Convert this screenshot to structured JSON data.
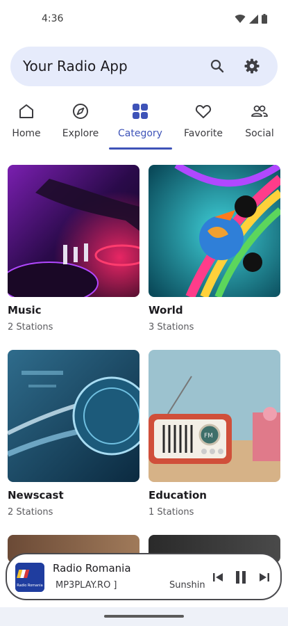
{
  "status_bar": {
    "time": "4:36"
  },
  "app_bar": {
    "title": "Your Radio App"
  },
  "tabs": [
    {
      "label": "Home",
      "icon": "home-icon"
    },
    {
      "label": "Explore",
      "icon": "compass-icon"
    },
    {
      "label": "Category",
      "icon": "grid-icon",
      "active": true
    },
    {
      "label": "Favorite",
      "icon": "heart-icon"
    },
    {
      "label": "Social",
      "icon": "people-icon"
    }
  ],
  "categories": [
    {
      "title": "Music",
      "count": "2 Stations"
    },
    {
      "title": "World",
      "count": "3 Stations"
    },
    {
      "title": "Newscast",
      "count": "2 Stations"
    },
    {
      "title": "Education",
      "count": "1 Stations"
    }
  ],
  "player": {
    "title": "Radio Romania",
    "subtitle": "MP3PLAY.RO ]",
    "marquee": "Sunshine",
    "logo_text": "Radio Romania"
  },
  "colors": {
    "accent": "#3e53b8",
    "search_bg": "#e6ebfb"
  }
}
